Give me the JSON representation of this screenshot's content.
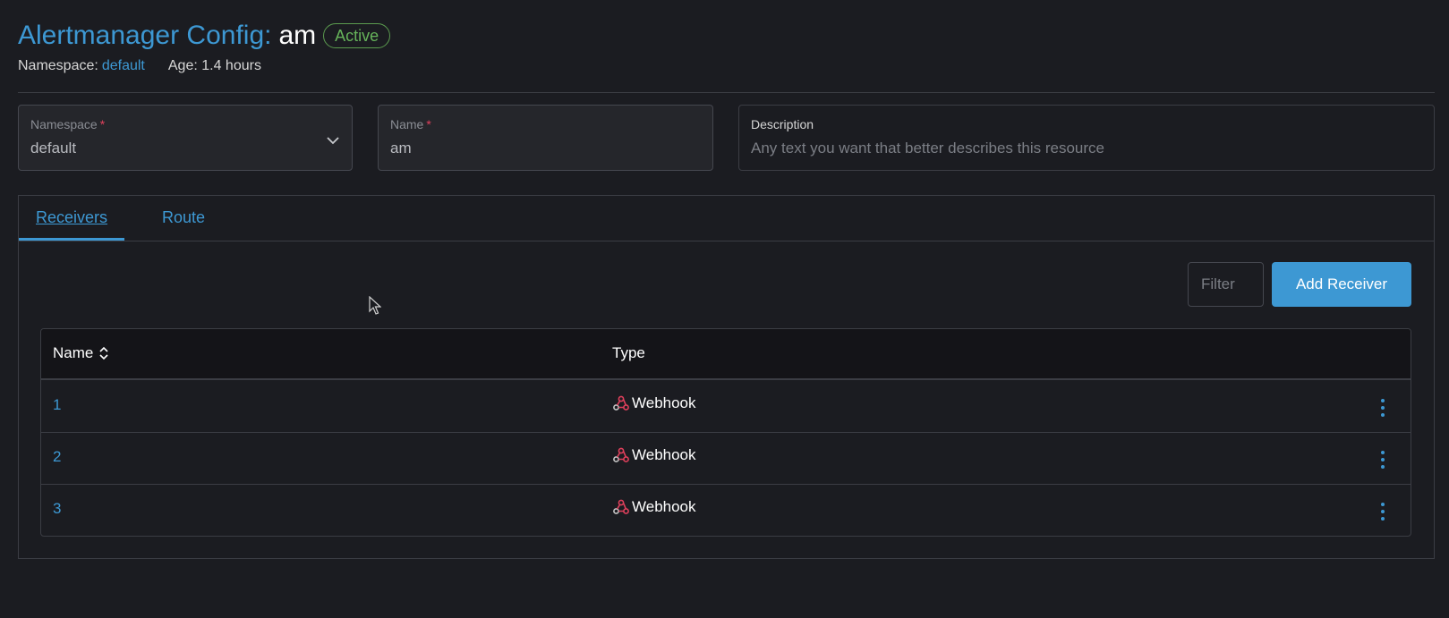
{
  "header": {
    "title_prefix": "Alertmanager Config:",
    "title_name": "am",
    "state": "Active",
    "namespace_label": "Namespace:",
    "namespace_value": "default",
    "age": "Age: 1.4 hours"
  },
  "form": {
    "namespace": {
      "label": "Namespace",
      "required_mark": "*",
      "value": "default"
    },
    "name": {
      "label": "Name",
      "required_mark": "*",
      "value": "am"
    },
    "description": {
      "label": "Description",
      "placeholder": "Any text you want that better describes this resource"
    }
  },
  "tabs": [
    {
      "label": "Receivers",
      "active": true
    },
    {
      "label": "Route",
      "active": false
    }
  ],
  "toolbar": {
    "filter_placeholder": "Filter",
    "add_receiver_label": "Add Receiver"
  },
  "table": {
    "columns": [
      "Name",
      "Type"
    ],
    "rows": [
      {
        "name": "1",
        "type": "Webhook"
      },
      {
        "name": "2",
        "type": "Webhook"
      },
      {
        "name": "3",
        "type": "Webhook"
      }
    ]
  },
  "colors": {
    "accent": "#3d98d3",
    "active_badge": "#66b35a",
    "required": "#e0405c",
    "background": "#1b1c21"
  }
}
